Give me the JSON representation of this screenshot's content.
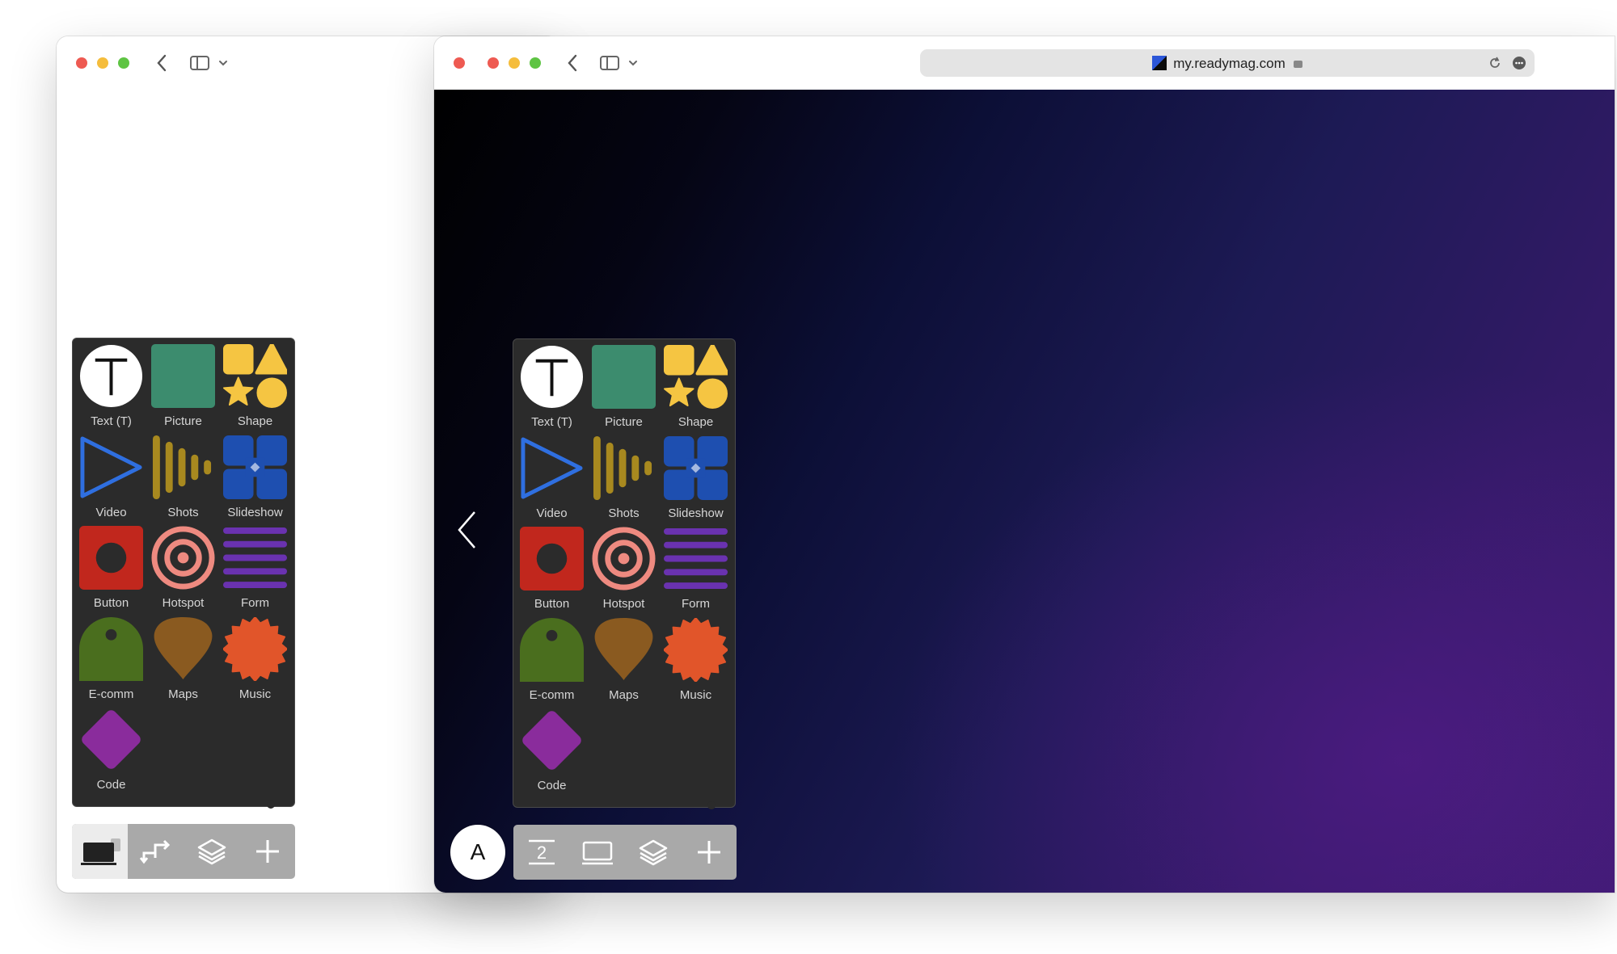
{
  "browser": {
    "url": "my.readymag.com"
  },
  "widgets": [
    {
      "id": "text",
      "label": "Text (T)",
      "icon": "text-icon"
    },
    {
      "id": "picture",
      "label": "Picture",
      "icon": "picture-icon"
    },
    {
      "id": "shape",
      "label": "Shape",
      "icon": "shape-icon"
    },
    {
      "id": "video",
      "label": "Video",
      "icon": "video-icon"
    },
    {
      "id": "shots",
      "label": "Shots",
      "icon": "shots-icon"
    },
    {
      "id": "slideshow",
      "label": "Slideshow",
      "icon": "slideshow-icon"
    },
    {
      "id": "button",
      "label": "Button",
      "icon": "button-widget-icon"
    },
    {
      "id": "hotspot",
      "label": "Hotspot",
      "icon": "hotspot-icon"
    },
    {
      "id": "form",
      "label": "Form",
      "icon": "form-icon"
    },
    {
      "id": "ecomm",
      "label": "E-comm",
      "icon": "ecomm-icon"
    },
    {
      "id": "maps",
      "label": "Maps",
      "icon": "maps-icon"
    },
    {
      "id": "music",
      "label": "Music",
      "icon": "music-icon"
    },
    {
      "id": "code",
      "label": "Code",
      "icon": "code-icon"
    }
  ],
  "toolbar": {
    "avatar_letter": "A",
    "page_number": "2"
  },
  "colors": {
    "text_bg": "#ffffff",
    "picture": "#3c8c6e",
    "shape": "#f5c542",
    "video": "#2f6fe0",
    "shots": "#a8891f",
    "slideshow": "#1e4fb0",
    "button": "#c1271d",
    "hotspot": "#ee8a80",
    "form": "#6a32b0",
    "ecomm": "#4a6e1e",
    "maps": "#8a5a20",
    "music": "#e1552a",
    "code": "#8a2c9c"
  }
}
